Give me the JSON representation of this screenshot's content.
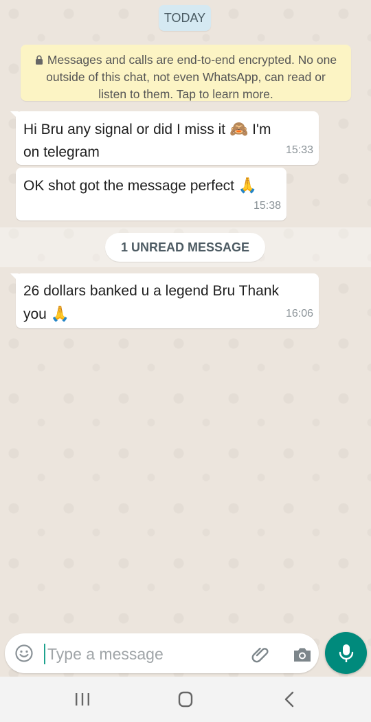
{
  "chat": {
    "date_chip": "TODAY",
    "encryption_notice": "Messages and calls are end-to-end encrypted. No one outside of this chat, not even WhatsApp, can read or listen to them. Tap to learn more.",
    "messages": [
      {
        "line1": "Hi Bru any signal or did I miss it ",
        "line1_emoji": "🙈",
        "line1_after": " I'm",
        "line2": "on telegram",
        "time": "15:33"
      },
      {
        "line1": "OK shot got the message perfect ",
        "line1_emoji": "🙏",
        "time": "15:38"
      },
      {
        "line1": "26 dollars banked u a legend Bru Thank",
        "line2": "you ",
        "line2_emoji": "🙏",
        "time": "16:06"
      }
    ],
    "unread_label": "1 UNREAD MESSAGE"
  },
  "composer": {
    "placeholder": "Type a message",
    "value": ""
  },
  "colors": {
    "accent": "#008a7c",
    "bubble": "#ffffff",
    "wallpaper": "#ece5dd",
    "notice": "#fcf4c4",
    "date_chip": "#d5e9f2"
  },
  "icons": {
    "emoji_button": "emoji-face-icon",
    "attach_button": "paperclip-icon",
    "camera_button": "camera-icon",
    "mic_button": "microphone-icon",
    "nav_recents": "recents-icon",
    "nav_home": "home-icon",
    "nav_back": "back-icon",
    "lock": "lock-icon"
  }
}
